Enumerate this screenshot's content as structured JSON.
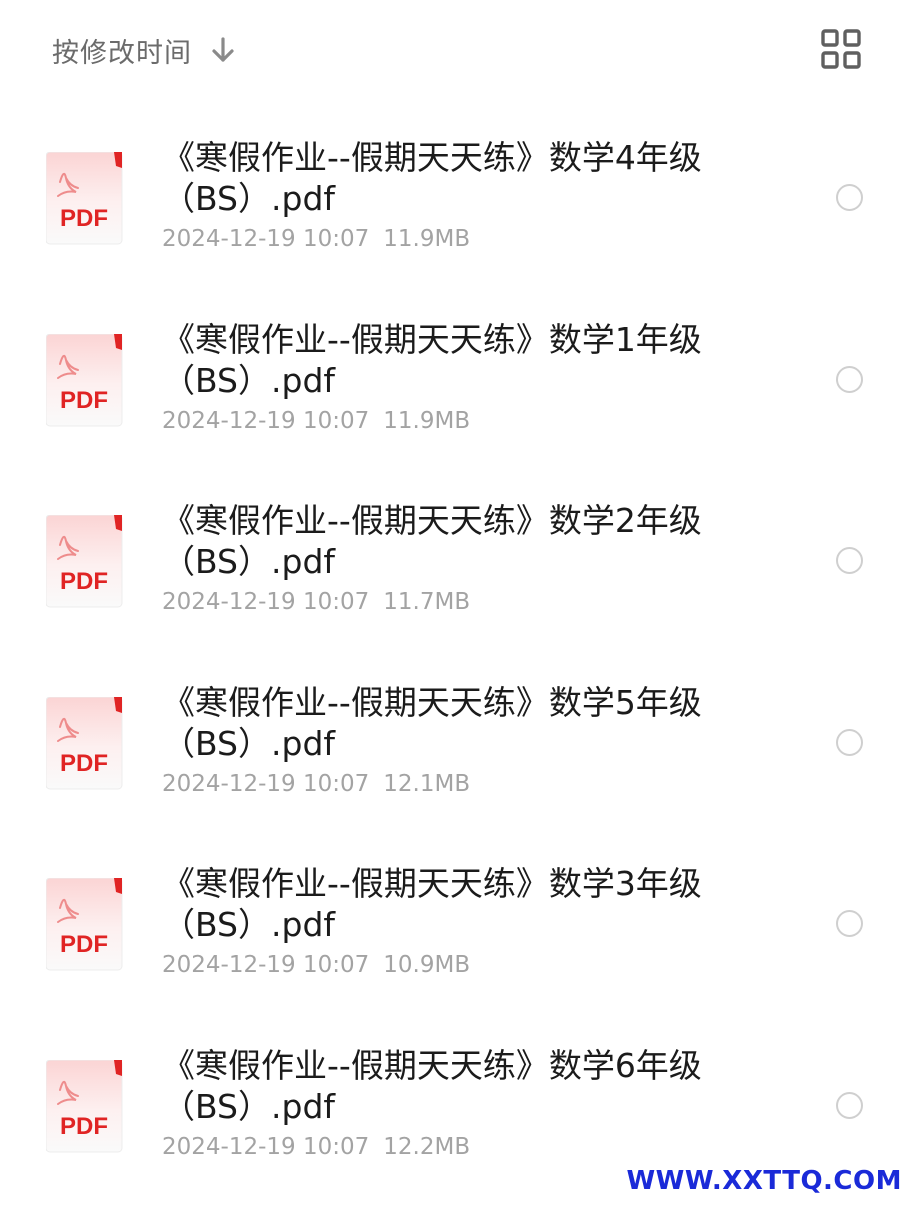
{
  "header": {
    "sort_label": "按修改时间",
    "sort_icon": "arrow-down-icon",
    "view_toggle_icon": "grid-view-icon"
  },
  "file_icon": {
    "type_label": "PDF",
    "accent_color": "#e02424"
  },
  "files": [
    {
      "name": "《寒假作业--假期天天练》数学4年级（BS）.pdf",
      "date": "2024-12-19 10:07",
      "size": "11.9MB"
    },
    {
      "name": "《寒假作业--假期天天练》数学1年级（BS）.pdf",
      "date": "2024-12-19 10:07",
      "size": "11.9MB"
    },
    {
      "name": "《寒假作业--假期天天练》数学2年级（BS）.pdf",
      "date": "2024-12-19 10:07",
      "size": "11.7MB"
    },
    {
      "name": "《寒假作业--假期天天练》数学5年级（BS）.pdf",
      "date": "2024-12-19 10:07",
      "size": "12.1MB"
    },
    {
      "name": "《寒假作业--假期天天练》数学3年级（BS）.pdf",
      "date": "2024-12-19 10:07",
      "size": "10.9MB"
    },
    {
      "name": "《寒假作业--假期天天练》数学6年级（BS）.pdf",
      "date": "2024-12-19 10:07",
      "size": "12.2MB"
    }
  ],
  "watermark": {
    "text": "WWW.XXTTQ.COM",
    "color": "#1a2ad8"
  }
}
